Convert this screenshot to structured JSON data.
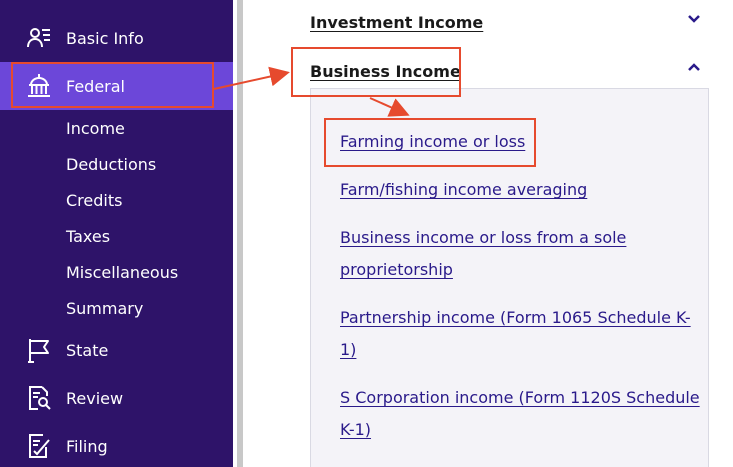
{
  "sidebar": {
    "items": [
      {
        "label": "Basic Info",
        "icon": "person-list-icon"
      },
      {
        "label": "Federal",
        "icon": "capitol-building-icon"
      },
      {
        "label": "State",
        "icon": "flag-icon"
      },
      {
        "label": "Review",
        "icon": "document-search-icon"
      },
      {
        "label": "Filing",
        "icon": "document-check-icon"
      }
    ],
    "subitems": [
      "Income",
      "Deductions",
      "Credits",
      "Taxes",
      "Miscellaneous",
      "Summary"
    ]
  },
  "main": {
    "sections": [
      {
        "title": "Investment Income",
        "expanded": false
      },
      {
        "title": "Business Income",
        "expanded": true
      }
    ],
    "links": [
      "Farming income or loss",
      "Farm/fishing income averaging",
      "Business income or loss from a sole",
      "proprietorship",
      "Partnership income (Form 1065 Schedule K-",
      "1)",
      "S Corporation income (Form 1120S Schedule",
      "K-1)"
    ]
  },
  "colors": {
    "sidebar_bg": "#2e1369",
    "active_bg": "#6c47d9",
    "link": "#2a1a8a",
    "annotation": "#e64a2e"
  }
}
